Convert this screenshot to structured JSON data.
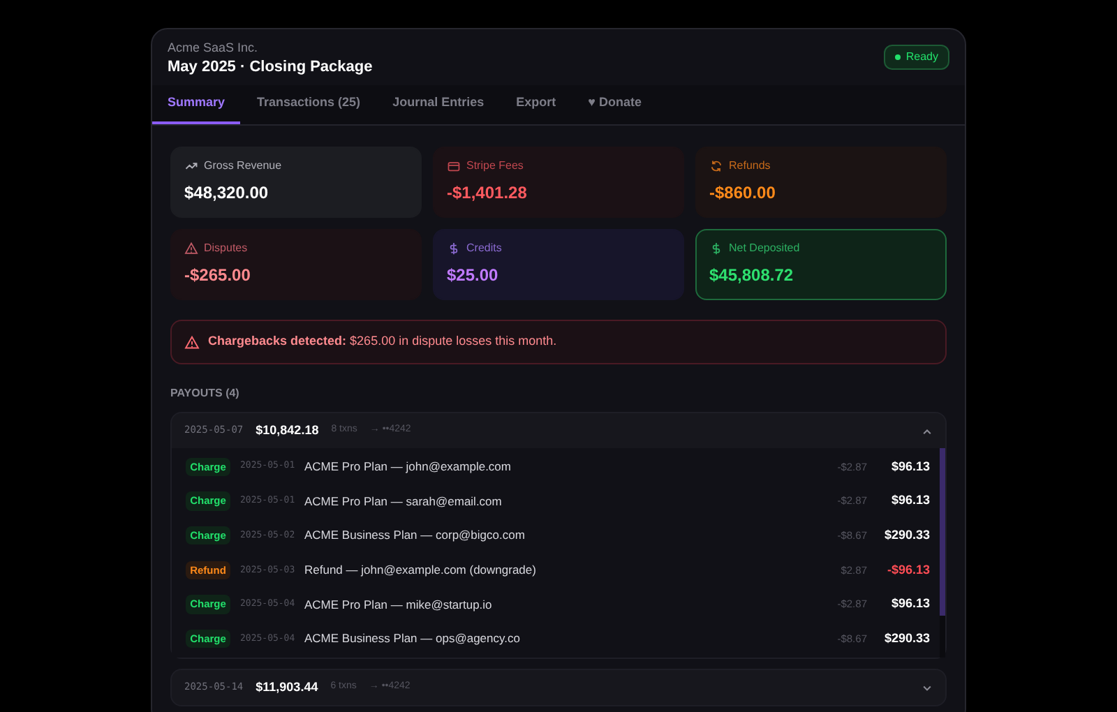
{
  "header": {
    "company": "Acme SaaS Inc.",
    "title": "May 2025 · Closing Package",
    "status": "Ready"
  },
  "tabs": [
    {
      "label": "Summary",
      "selected": true
    },
    {
      "label": "Transactions (25)",
      "selected": false
    },
    {
      "label": "Journal Entries",
      "selected": false
    },
    {
      "label": "Export",
      "selected": false
    },
    {
      "label": "♥ Donate",
      "selected": false
    }
  ],
  "stats": [
    {
      "kind": "gross",
      "label": "Gross Revenue",
      "value": "$48,320.00"
    },
    {
      "kind": "fees",
      "label": "Stripe Fees",
      "value": "-$1,401.28"
    },
    {
      "kind": "refunds",
      "label": "Refunds",
      "value": "-$860.00"
    },
    {
      "kind": "disputes",
      "label": "Disputes",
      "value": "-$265.00"
    },
    {
      "kind": "credits",
      "label": "Credits",
      "value": "$25.00"
    },
    {
      "kind": "net",
      "label": "Net Deposited",
      "value": "$45,808.72"
    }
  ],
  "alert": "**Chargebacks detected:** $265.00 in dispute losses this month.",
  "payouts_label": "PAYOUTS (4)",
  "payouts": [
    {
      "date": "2025-05-07",
      "amount": "$10,842.18",
      "count": "8 txns",
      "account": "→ ••4242",
      "expanded": true,
      "transactions": [
        {
          "kind": "charge",
          "type": "Charge",
          "date": "2025-05-01",
          "description": "ACME Pro Plan — john@example.com",
          "fee": "-$2.87",
          "amount": "$96.13"
        },
        {
          "kind": "charge",
          "type": "Charge",
          "date": "2025-05-01",
          "description": "ACME Pro Plan — sarah@email.com",
          "fee": "-$2.87",
          "amount": "$96.13"
        },
        {
          "kind": "charge",
          "type": "Charge",
          "date": "2025-05-02",
          "description": "ACME Business Plan — corp@bigco.com",
          "fee": "-$8.67",
          "amount": "$290.33"
        },
        {
          "kind": "refund",
          "type": "Refund",
          "date": "2025-05-03",
          "description": "Refund — john@example.com (downgrade)",
          "fee": "$2.87",
          "amount": "-$96.13"
        },
        {
          "kind": "charge",
          "type": "Charge",
          "date": "2025-05-04",
          "description": "ACME Pro Plan — mike@startup.io",
          "fee": "-$2.87",
          "amount": "$96.13"
        },
        {
          "kind": "charge",
          "type": "Charge",
          "date": "2025-05-04",
          "description": "ACME Business Plan — ops@agency.co",
          "fee": "-$8.67",
          "amount": "$290.33"
        }
      ]
    },
    {
      "date": "2025-05-14",
      "amount": "$11,903.44",
      "count": "6 txns",
      "account": "→ ••4242",
      "expanded": false
    }
  ]
}
